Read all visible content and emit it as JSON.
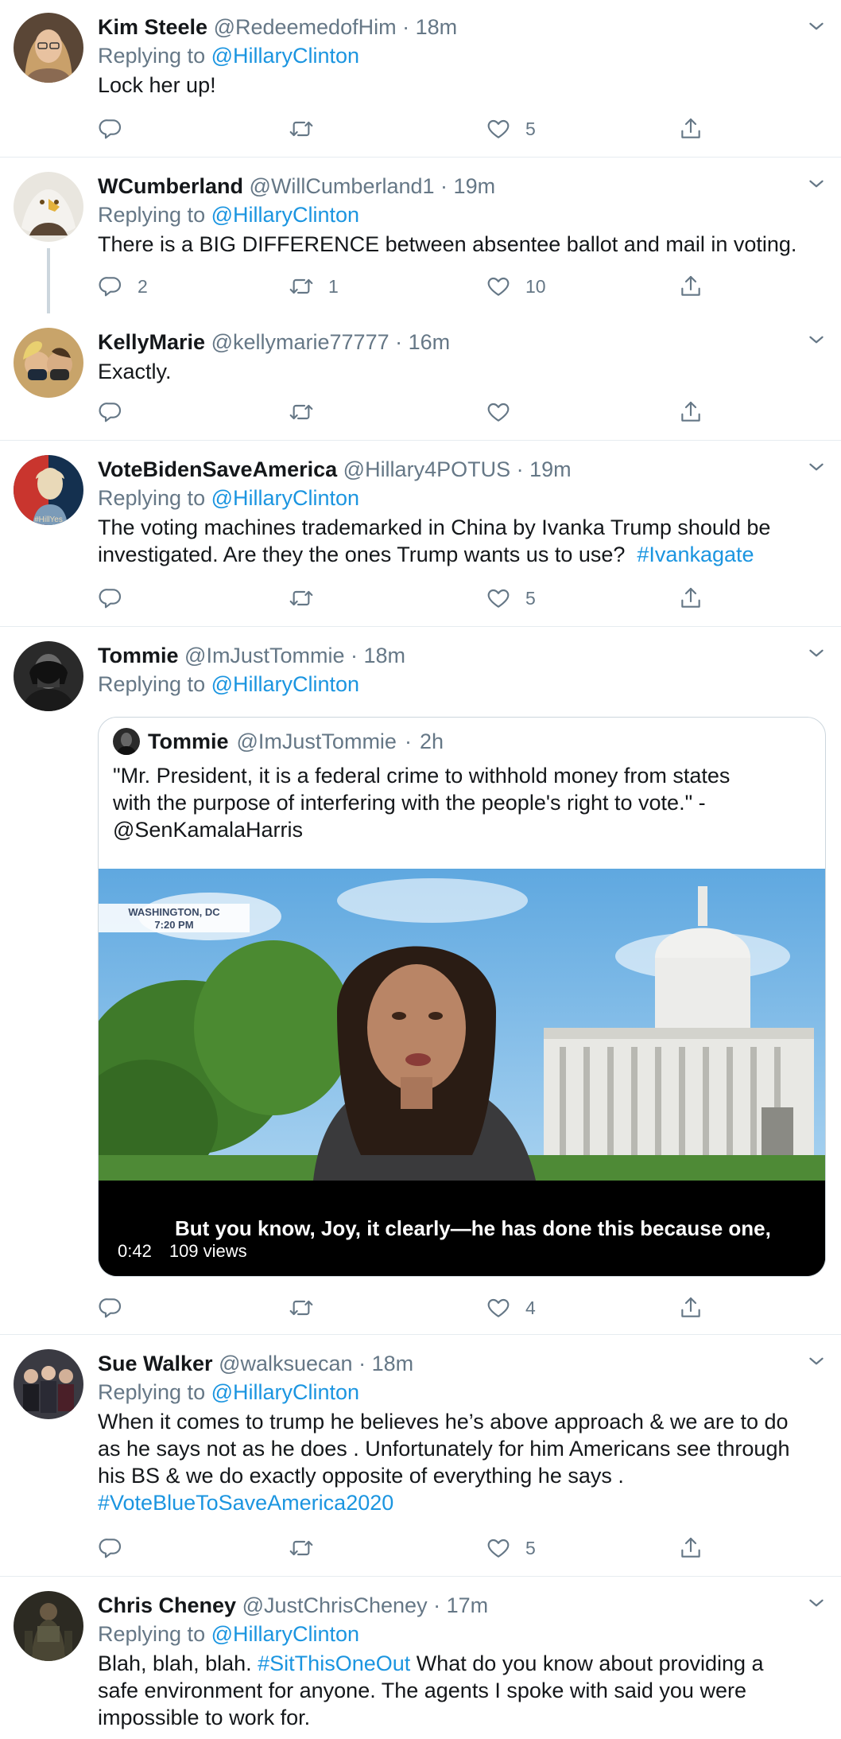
{
  "reply_prefix": "Replying to",
  "icons": {
    "reply": "reply-icon",
    "retweet": "retweet-icon",
    "like": "heart-icon",
    "share": "share-icon",
    "more": "chevron-down-icon"
  },
  "colors": {
    "link": "#1b95e0",
    "muted": "#657786",
    "text": "#14171a",
    "border": "#e6ecf0"
  },
  "tweets": [
    {
      "name": "Kim Steele",
      "handle": "@RedeemedofHim",
      "time": "18m",
      "replying_to": "@HillaryClinton",
      "text": "Lock her up!",
      "replies": "",
      "retweets": "",
      "likes": "5"
    },
    {
      "name": "WCumberland",
      "handle": "@WillCumberland1",
      "time": "19m",
      "replying_to": "@HillaryClinton",
      "text": "There is a BIG DIFFERENCE between absentee ballot and mail in voting.",
      "replies": "2",
      "retweets": "1",
      "likes": "10"
    },
    {
      "name": "KellyMarie",
      "handle": "@kellymarie77777",
      "time": "16m",
      "text": "Exactly.",
      "replies": "",
      "retweets": "",
      "likes": ""
    },
    {
      "name": "VoteBidenSaveAmerica",
      "handle": "@Hillary4POTUS",
      "time": "19m",
      "replying_to": "@HillaryClinton",
      "text_line1": "The voting machines trademarked in China by Ivanka Trump should be",
      "text_line2": "investigated.  Are they the ones Trump wants us to use?",
      "hashtag": "#Ivankagate",
      "avatar_text": "#HillYes",
      "replies": "",
      "retweets": "",
      "likes": "5"
    },
    {
      "name": "Tommie",
      "handle": "@ImJustTommie",
      "time": "18m",
      "replying_to": "@HillaryClinton",
      "quote": {
        "name": "Tommie",
        "handle": "@ImJustTommie",
        "time": "2h",
        "text_line1": "\"Mr. President, it is a federal crime to withhold money from states",
        "text_line2": "with the purpose of interfering with the people's right to vote.\" -",
        "text_line3": "@SenKamalaHarris",
        "overlay_line1": "WASHINGTON, DC",
        "overlay_line2": "7:20 PM",
        "caption": "But you know, Joy, it clearly—he has done this because one,",
        "duration": "0:42",
        "views": "109 views"
      },
      "replies": "",
      "retweets": "",
      "likes": "4"
    },
    {
      "name": "Sue Walker",
      "handle": "@walksuecan",
      "time": "18m",
      "replying_to": "@HillaryClinton",
      "text_line1": "When it comes to trump he believes he’s above approach & we are to do",
      "text_line2": "as he says not as he does . Unfortunately for him Americans see through",
      "text_line3": "his BS & we do exactly opposite of everything he says .",
      "hashtag": "#VoteBlueToSaveAmerica2020",
      "replies": "",
      "retweets": "",
      "likes": "5"
    },
    {
      "name": "Chris Cheney",
      "handle": "@JustChrisCheney",
      "time": "17m",
      "replying_to": "@HillaryClinton",
      "text_prefix": "Blah, blah, blah.",
      "hashtag": "#SitThisOneOut",
      "text_line1_rest": "What do you know about providing a",
      "text_line2": "safe environment for anyone. The agents I spoke with said you were",
      "text_line3": "impossible to work for."
    }
  ]
}
